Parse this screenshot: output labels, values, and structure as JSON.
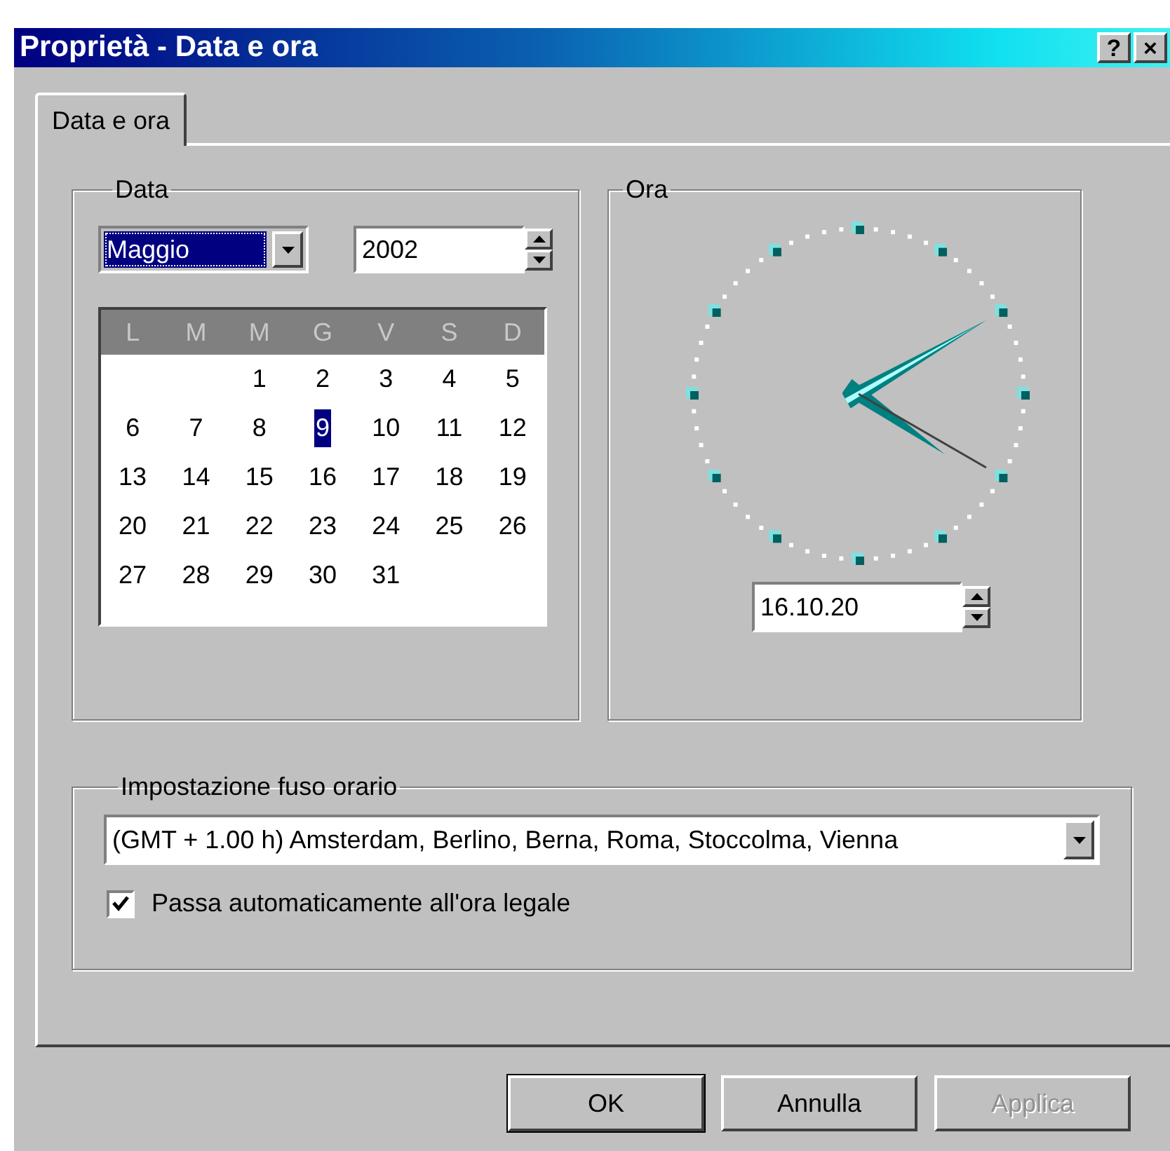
{
  "window": {
    "title": "Proprietà - Data e ora",
    "help_button": "?",
    "close_button": "×"
  },
  "tabs": [
    {
      "label": "Data e ora",
      "selected": true
    }
  ],
  "date_group": {
    "label": "Data",
    "month": "Maggio",
    "year": "2002",
    "weekdays": [
      "L",
      "M",
      "M",
      "G",
      "V",
      "S",
      "D"
    ],
    "weeks": [
      {
        "days": [
          {
            "label": "1",
            "selected": false
          },
          {
            "label": "2",
            "selected": false
          },
          {
            "label": "3",
            "selected": false
          },
          {
            "label": "4",
            "selected": false
          },
          {
            "label": "5",
            "selected": false
          }
        ]
      },
      {
        "days": [
          {
            "label": "6",
            "selected": false
          },
          {
            "label": "7",
            "selected": false
          },
          {
            "label": "8",
            "selected": false
          },
          {
            "label": "9",
            "selected": true
          },
          {
            "label": "10",
            "selected": false
          },
          {
            "label": "11",
            "selected": false
          },
          {
            "label": "12",
            "selected": false
          }
        ]
      },
      {
        "days": [
          {
            "label": "13",
            "selected": false
          },
          {
            "label": "14",
            "selected": false
          },
          {
            "label": "15",
            "selected": false
          },
          {
            "label": "16",
            "selected": false
          },
          {
            "label": "17",
            "selected": false
          },
          {
            "label": "18",
            "selected": false
          },
          {
            "label": "19",
            "selected": false
          }
        ]
      },
      {
        "days": [
          {
            "label": "20",
            "selected": false
          },
          {
            "label": "21",
            "selected": false
          },
          {
            "label": "22",
            "selected": false
          },
          {
            "label": "23",
            "selected": false
          },
          {
            "label": "24",
            "selected": false
          },
          {
            "label": "25",
            "selected": false
          },
          {
            "label": "26",
            "selected": false
          }
        ]
      },
      {
        "days": [
          {
            "label": "27",
            "selected": false
          },
          {
            "label": "28",
            "selected": false
          },
          {
            "label": "29",
            "selected": false
          },
          {
            "label": "30",
            "selected": false
          },
          {
            "label": "31",
            "selected": false
          }
        ]
      }
    ]
  },
  "time_group": {
    "label": "Ora",
    "time": "16.10.20"
  },
  "timezone_group": {
    "label": "Impostazione fuso orario",
    "timezone": "(GMT + 1.00 h) Amsterdam, Berlino, Berna, Roma, Stoccolma, Vienna",
    "auto_dst": {
      "label": "Passa automaticamente all'ora legale",
      "checked": true
    }
  },
  "buttons": [
    {
      "label": "OK",
      "disabled": false
    },
    {
      "label": "Annulla",
      "disabled": false
    },
    {
      "label": "Applica",
      "disabled": true
    }
  ]
}
